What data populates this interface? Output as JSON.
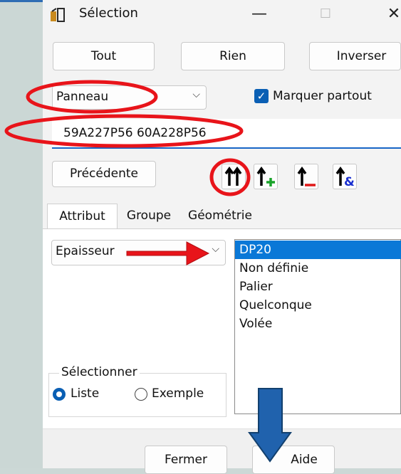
{
  "window": {
    "title": "Sélection",
    "minimize_glyph": "—",
    "maximize_glyph": "☐",
    "close_glyph": "✕"
  },
  "selection_buttons": {
    "all": "Tout",
    "none": "Rien",
    "invert": "Inverser"
  },
  "type_combo": {
    "value": "Panneau",
    "icon": "chevron-down-icon"
  },
  "mark_everywhere": {
    "label": "Marquer partout",
    "checked": true
  },
  "selection_text": {
    "value": "59A227P56 60A228P56"
  },
  "previous_button": "Précédente",
  "mode_icons": [
    "select-replace-icon",
    "select-add-icon",
    "select-remove-icon",
    "select-intersect-icon"
  ],
  "tabs": [
    "Attribut",
    "Groupe",
    "Géométrie"
  ],
  "active_tab": "Attribut",
  "attribute_combo": {
    "value": "Epaisseur",
    "icon": "chevron-down-icon"
  },
  "values_list": [
    "DP20",
    "Non définie",
    "Palier",
    "Quelconque",
    "Volée"
  ],
  "selected_value": "DP20",
  "select_group": {
    "label": "Sélectionner",
    "options": [
      "Liste",
      "Exemple"
    ],
    "selected": "Liste"
  },
  "footer": {
    "close": "Fermer",
    "help": "Aide"
  },
  "colors": {
    "accent": "#0a5fb4",
    "annotation_red": "#e8141a",
    "annotation_blue": "#1f5fa8"
  }
}
